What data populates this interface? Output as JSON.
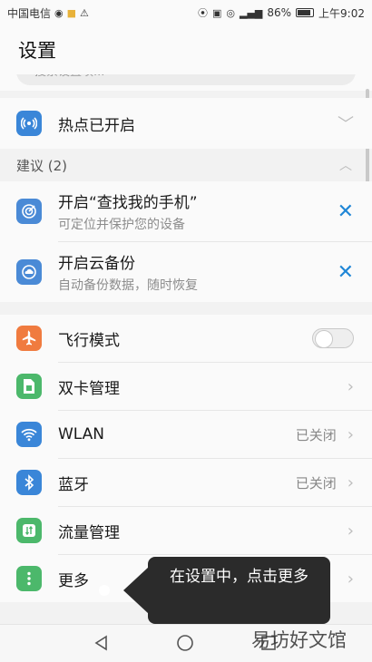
{
  "status_bar": {
    "carrier": "中国电信",
    "battery_percent": "86%",
    "time": "上午9:02",
    "icons": [
      "camera-icon",
      "notification-icon",
      "warning-icon",
      "hotspot-icon",
      "cast-icon",
      "eye-icon",
      "signal-icon",
      "battery-icon"
    ]
  },
  "header": {
    "title": "设置"
  },
  "search": {
    "placeholder": "搜索设置项..."
  },
  "hotspot": {
    "label": "热点已开启",
    "icon": "hotspot-icon",
    "color": "#3a86d8"
  },
  "suggestions": {
    "header": "建议 (2)",
    "items": [
      {
        "label": "开启“查找我的手机”",
        "sub": "可定位并保护您的设备",
        "icon": "target-icon",
        "color": "#4a8ad6"
      },
      {
        "label": "开启云备份",
        "sub": "自动备份数据，随时恢复",
        "icon": "cloud-icon",
        "color": "#4a8ad6"
      }
    ]
  },
  "settings": [
    {
      "label": "飞行模式",
      "icon": "airplane-icon",
      "color": "#f07b3f",
      "control": "toggle",
      "value": "off"
    },
    {
      "label": "双卡管理",
      "icon": "sim-icon",
      "color": "#4cb86b",
      "control": "chevron"
    },
    {
      "label": "WLAN",
      "icon": "wifi-icon",
      "color": "#3a86d8",
      "control": "chevron",
      "status": "已关闭"
    },
    {
      "label": "蓝牙",
      "icon": "bluetooth-icon",
      "color": "#3a86d8",
      "control": "chevron",
      "status": "已关闭"
    },
    {
      "label": "流量管理",
      "icon": "data-usage-icon",
      "color": "#4cb86b",
      "control": "chevron"
    },
    {
      "label": "更多",
      "icon": "more-icon",
      "color": "#4cb86b",
      "control": "chevron"
    }
  ],
  "tooltip": {
    "text": "在设置中，点击更多"
  },
  "watermark": "易坊好文馆",
  "navbar": {
    "icons": [
      "back-icon",
      "home-icon",
      "recents-icon"
    ]
  }
}
